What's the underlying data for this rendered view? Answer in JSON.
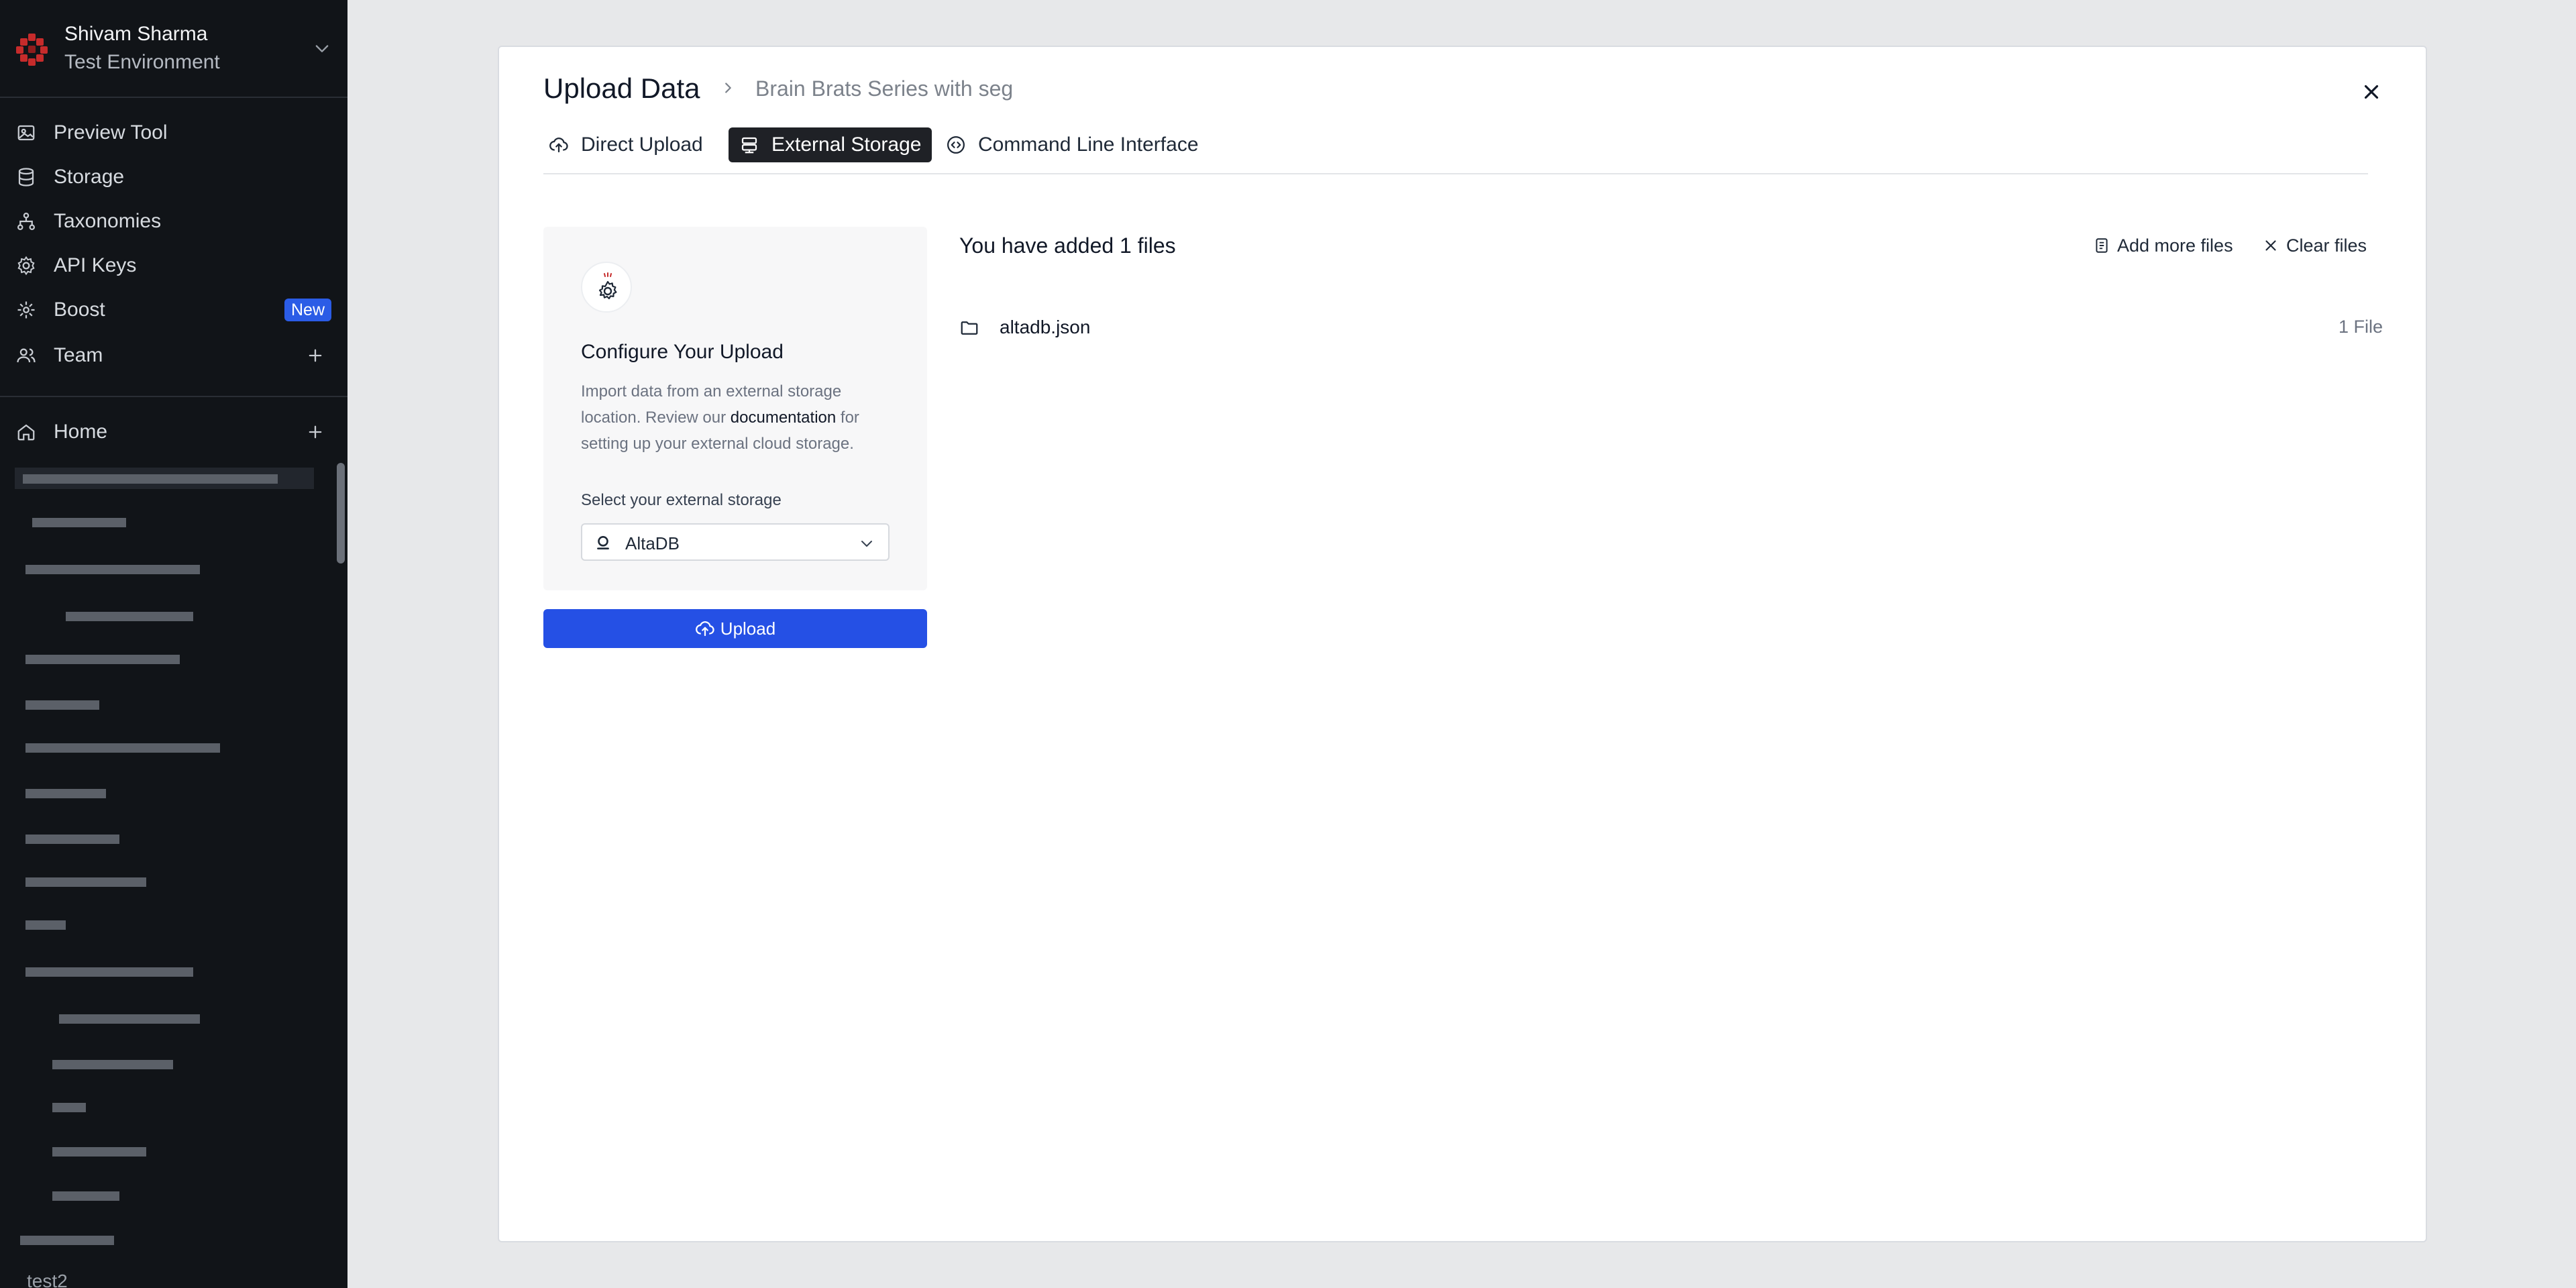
{
  "sidebar": {
    "workspace": {
      "name": "Shivam Sharma",
      "environment": "Test Environment"
    },
    "nav": [
      {
        "label": "Preview Tool",
        "icon": "image-icon"
      },
      {
        "label": "Storage",
        "icon": "database-icon"
      },
      {
        "label": "Taxonomies",
        "icon": "hierarchy-icon"
      },
      {
        "label": "API Keys",
        "icon": "gear-icon"
      },
      {
        "label": "Boost",
        "icon": "sparkle-icon",
        "badge": "New"
      },
      {
        "label": "Team",
        "icon": "users-icon"
      }
    ],
    "home_label": "Home",
    "last_item": "test2"
  },
  "modal": {
    "title": "Upload Data",
    "subtitle": "Brain Brats Series with seg",
    "tabs": [
      {
        "label": "Direct Upload",
        "icon": "cloud-upload-icon",
        "active": false
      },
      {
        "label": "External Storage",
        "icon": "storage-icon",
        "active": true
      },
      {
        "label": "Command Line Interface",
        "icon": "code-icon",
        "active": false
      }
    ],
    "config": {
      "title": "Configure Your Upload",
      "desc_before": "Import data from an external storage location. Review our ",
      "desc_link": "documentation",
      "desc_after": " for setting up your external cloud storage.",
      "select_label": "Select your external storage",
      "selected_storage": "AltaDB"
    },
    "upload_button": "Upload",
    "files": {
      "heading": "You have added 1 files",
      "add_more": "Add more files",
      "clear": "Clear files",
      "items": [
        {
          "name": "altadb.json",
          "count": "1 File"
        }
      ]
    }
  },
  "colors": {
    "accent": "#2550e5",
    "sidebar_bg": "#111418",
    "badge": "#2b5ce6"
  }
}
